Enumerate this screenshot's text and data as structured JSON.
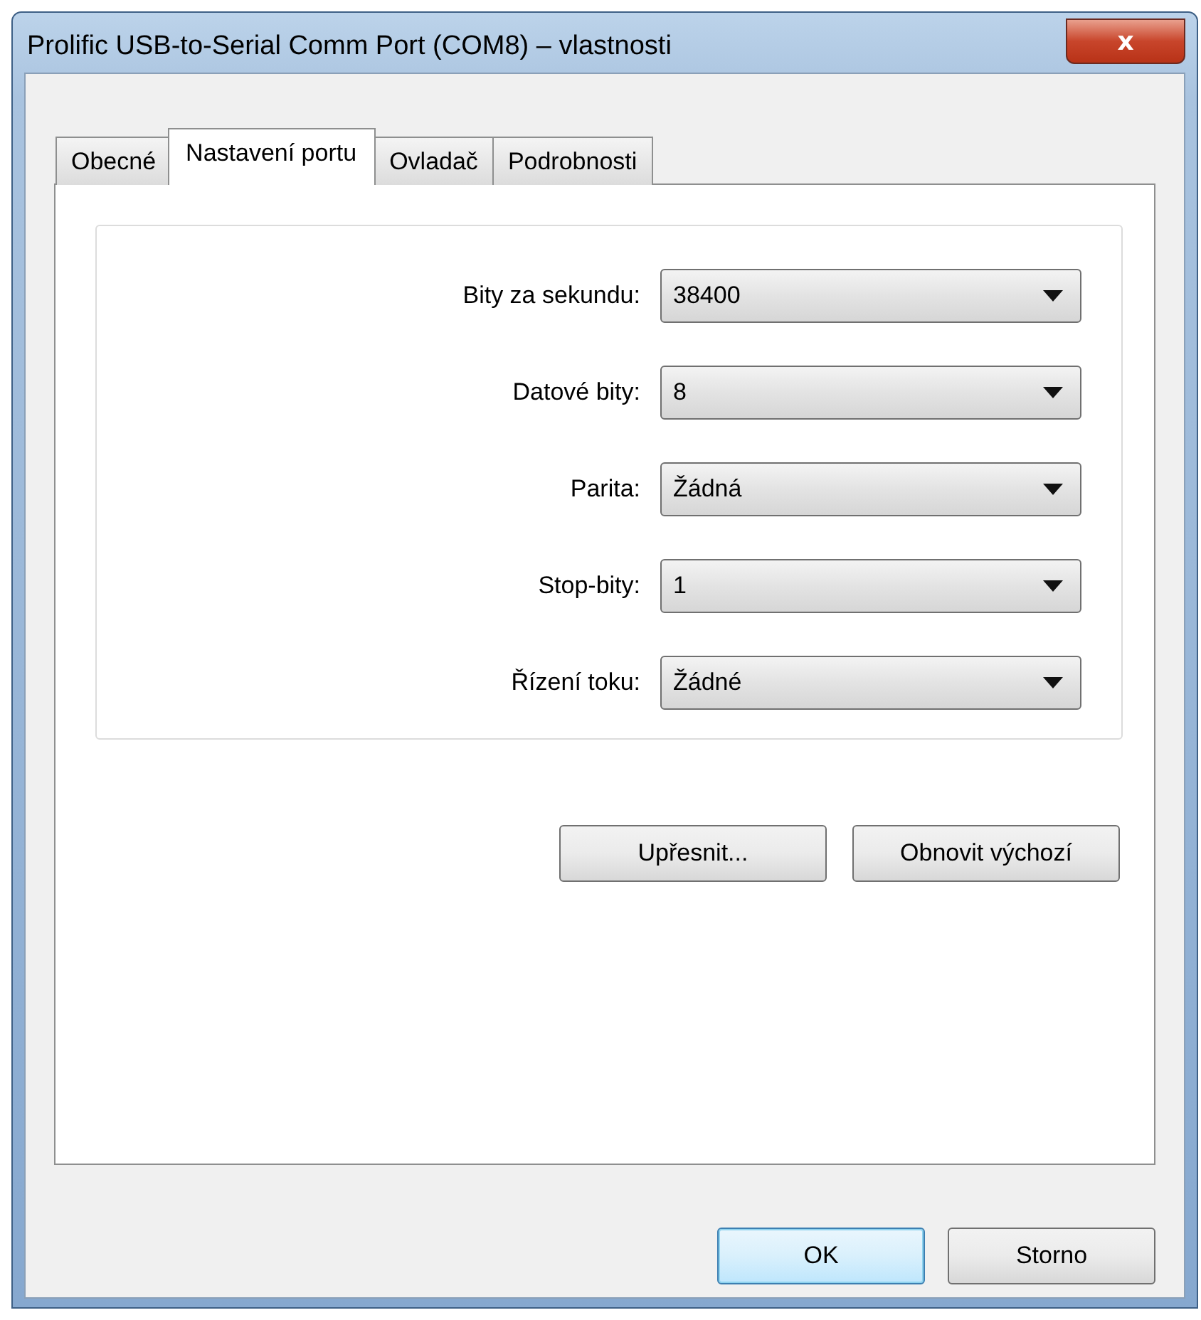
{
  "window": {
    "title": "Prolific USB-to-Serial Comm Port (COM8)  – vlastnosti",
    "close_button": "x"
  },
  "tabs": [
    {
      "label": "Obecné",
      "selected": false
    },
    {
      "label": "Nastavení portu",
      "selected": true
    },
    {
      "label": "Ovladač",
      "selected": false
    },
    {
      "label": "Podrobnosti",
      "selected": false
    }
  ],
  "settings": [
    {
      "label": "Bity za sekundu:",
      "value": "38400"
    },
    {
      "label": "Datové bity:",
      "value": "8"
    },
    {
      "label": "Parita:",
      "value": "Žádná"
    },
    {
      "label": "Stop-bity:",
      "value": "1"
    },
    {
      "label": "Řízení toku:",
      "value": "Žádné"
    }
  ],
  "panel_buttons": [
    {
      "label": "Upřesnit..."
    },
    {
      "label": "Obnovit výchozí"
    }
  ],
  "dialog_buttons": [
    {
      "label": "OK",
      "default": true
    },
    {
      "label": "Storno",
      "default": false
    }
  ]
}
